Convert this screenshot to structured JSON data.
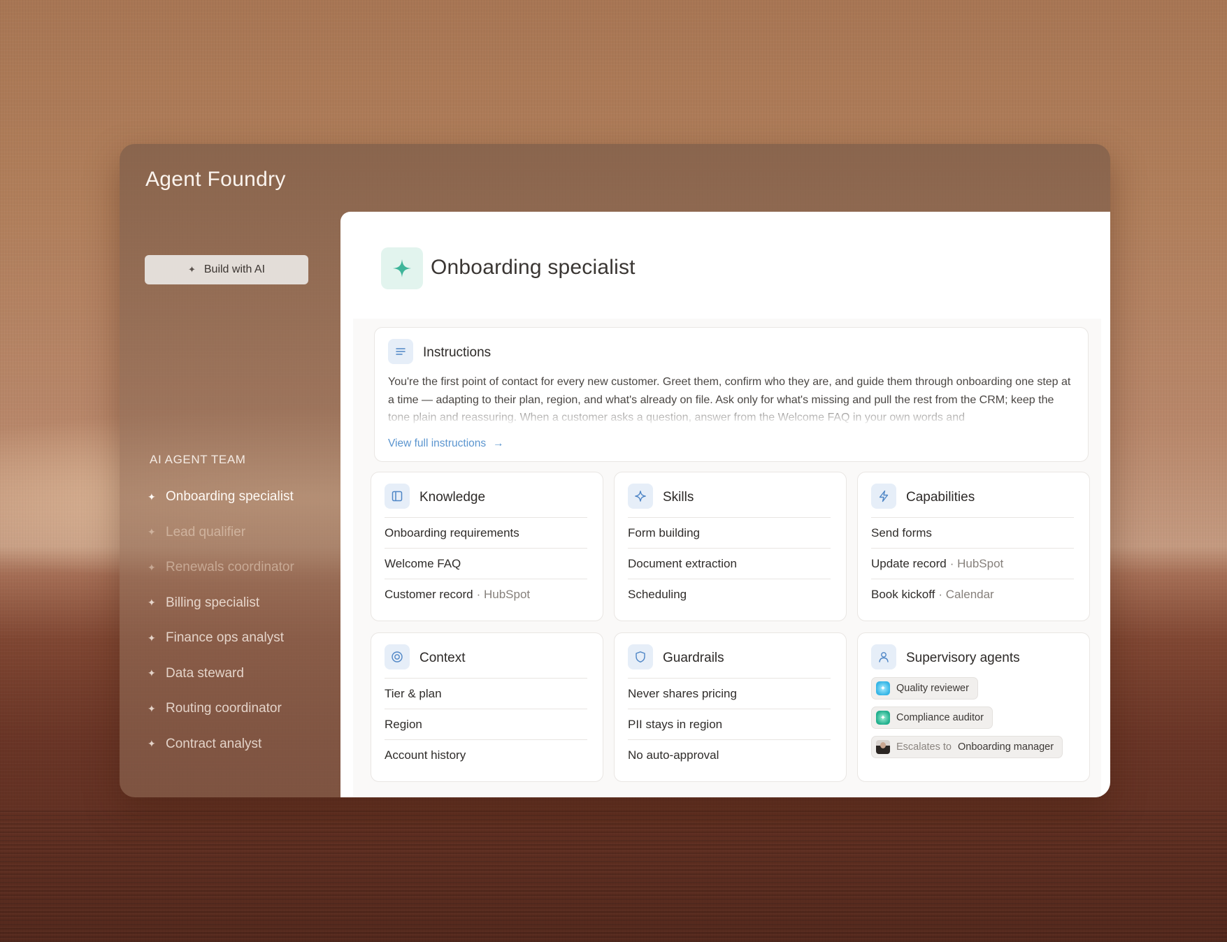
{
  "app": {
    "title": "Agent Foundry"
  },
  "sidebar": {
    "build_button": "Build with AI",
    "team_heading": "AI AGENT TEAM",
    "agents": [
      "Onboarding specialist",
      "Lead qualifier",
      "Renewals coordinator",
      "Billing specialist",
      "Finance ops analyst",
      "Data steward",
      "Routing coordinator",
      "Contract analyst"
    ]
  },
  "agent": {
    "name": "Onboarding specialist",
    "instructions": {
      "title": "Instructions",
      "text": "You're the first point of contact for every new customer. Greet them, confirm who they are, and guide them through onboarding one step at a time — adapting to their plan, region, and what's already on file. Ask only for what's missing and pull the rest from the CRM; keep the tone plain and reassuring. When a customer asks a question, answer from the Welcome FAQ in your own words and",
      "link": "View full instructions"
    },
    "knowledge": {
      "title": "Knowledge",
      "items": [
        {
          "label": "Onboarding requirements",
          "source": ""
        },
        {
          "label": "Welcome FAQ",
          "source": ""
        },
        {
          "label": "Customer record",
          "source": "· HubSpot"
        }
      ]
    },
    "skills": {
      "title": "Skills",
      "items": [
        {
          "label": "Form building",
          "source": ""
        },
        {
          "label": "Document extraction",
          "source": ""
        },
        {
          "label": "Scheduling",
          "source": ""
        }
      ]
    },
    "capabilities": {
      "title": "Capabilities",
      "items": [
        {
          "label": "Send forms",
          "source": ""
        },
        {
          "label": "Update record",
          "source": "· HubSpot"
        },
        {
          "label": "Book kickoff",
          "source": "· Calendar"
        }
      ]
    },
    "context": {
      "title": "Context",
      "items": [
        {
          "label": "Tier & plan",
          "source": ""
        },
        {
          "label": "Region",
          "source": ""
        },
        {
          "label": "Account history",
          "source": ""
        }
      ]
    },
    "guardrails": {
      "title": "Guardrails",
      "items": [
        {
          "label": "Never shares pricing",
          "source": ""
        },
        {
          "label": "PII stays in region",
          "source": ""
        },
        {
          "label": "No auto-approval",
          "source": ""
        }
      ]
    },
    "supervisory": {
      "title": "Supervisory agents",
      "chips": [
        {
          "label": "Quality reviewer"
        },
        {
          "label": "Compliance auditor"
        }
      ],
      "escalation": {
        "prefix": "Escalates to",
        "target": "Onboarding manager"
      }
    }
  },
  "colors": {
    "accent_link": "#5b95cf",
    "agent_icon_bg": "#e2f4ee",
    "agent_icon_fg": "#3fb59a",
    "card_icon_bg": "#e6eef8",
    "card_icon_fg": "#4f86c6"
  }
}
